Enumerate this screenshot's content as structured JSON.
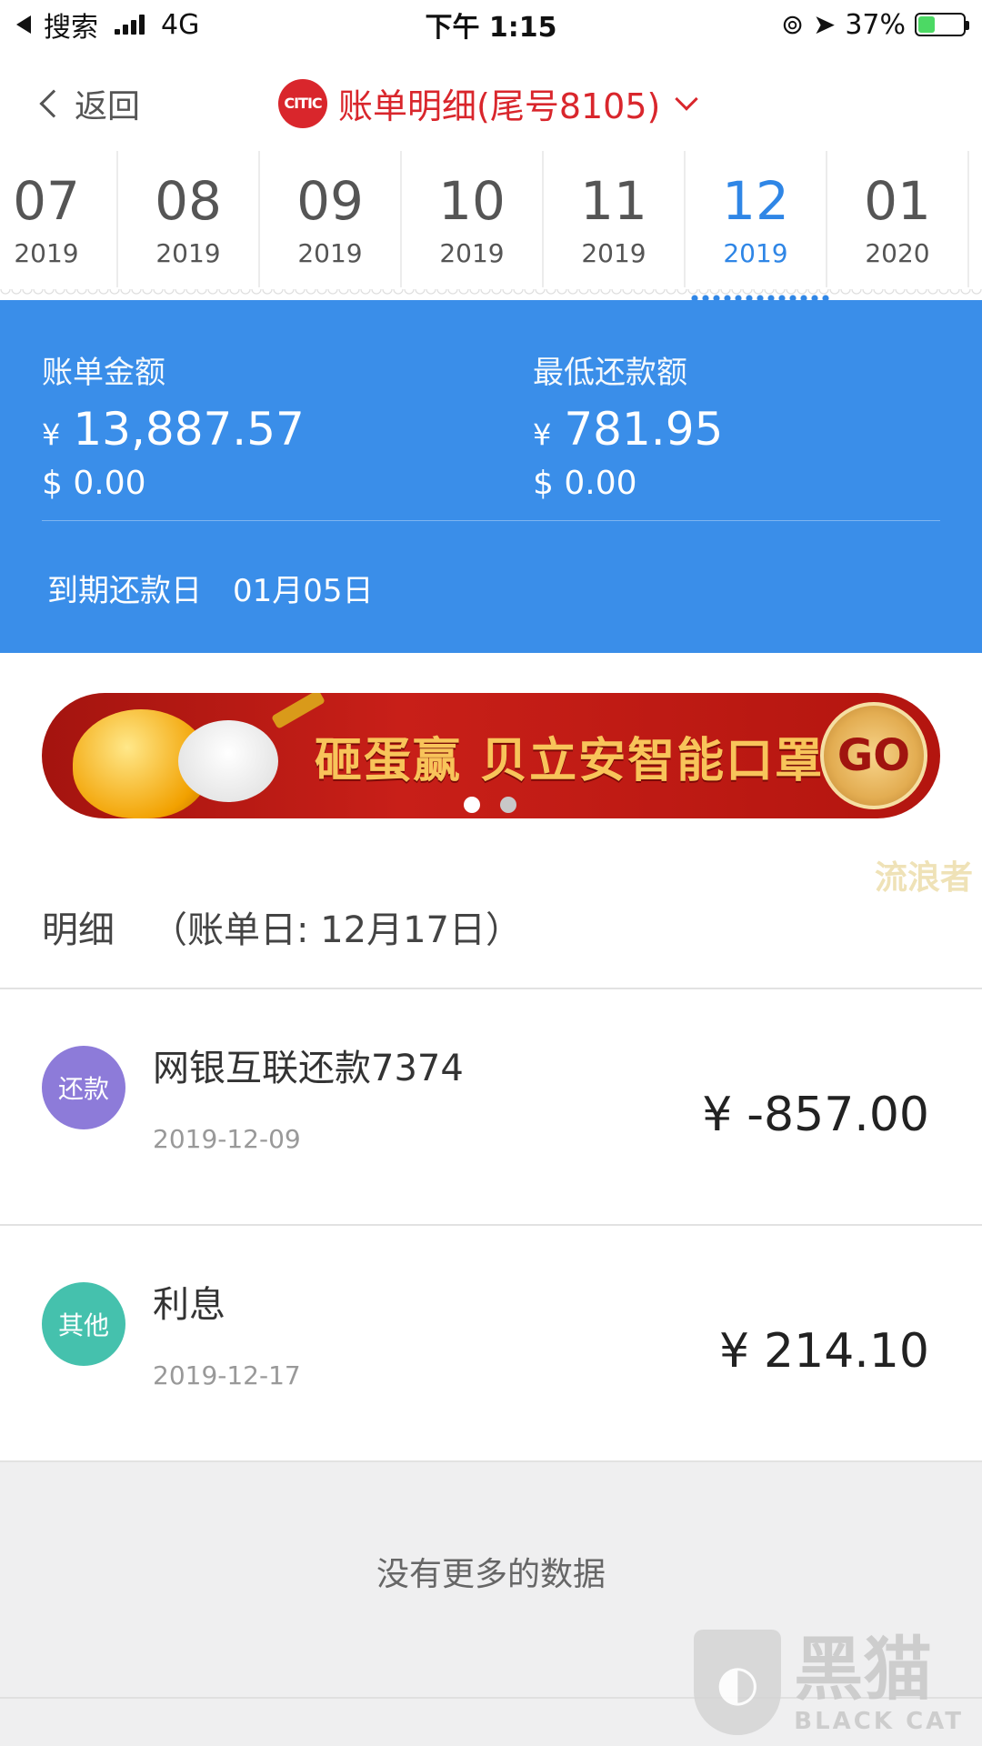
{
  "status_bar": {
    "back_app": "搜索",
    "network": "4G",
    "time": "下午 1:15",
    "battery_percent": "37%",
    "battery_level": 0.37
  },
  "nav": {
    "back_label": "返回",
    "bank_logo_text": "CITIC",
    "title": "账单明细(尾号8105)"
  },
  "months": [
    {
      "month": "07",
      "year": "2019",
      "active": false
    },
    {
      "month": "08",
      "year": "2019",
      "active": false
    },
    {
      "month": "09",
      "year": "2019",
      "active": false
    },
    {
      "month": "10",
      "year": "2019",
      "active": false
    },
    {
      "month": "11",
      "year": "2019",
      "active": false
    },
    {
      "month": "12",
      "year": "2019",
      "active": true
    },
    {
      "month": "01",
      "year": "2020",
      "active": false
    }
  ],
  "summary": {
    "bill_amount_label": "账单金额",
    "bill_amount_currency": "¥",
    "bill_amount": "13,887.57",
    "bill_amount_usd": "$ 0.00",
    "min_payment_label": "最低还款额",
    "min_payment_currency": "¥",
    "min_payment": "781.95",
    "min_payment_usd": "$ 0.00",
    "due_date_label": "到期还款日",
    "due_date": "01月05日"
  },
  "banner": {
    "text": "砸蛋赢 贝立安智能口罩",
    "go_label": "GO"
  },
  "watermark_text": "流浪者",
  "details": {
    "label": "明细",
    "statement_date": "（账单日: 12月17日）"
  },
  "transactions": [
    {
      "badge": "还款",
      "title": "网银互联还款7374",
      "date": "2019-12-09",
      "currency": "¥",
      "amount": "-857.00",
      "badge_color": "#8d7bd9"
    },
    {
      "badge": "其他",
      "title": "利息",
      "date": "2019-12-17",
      "currency": "¥",
      "amount": "214.10",
      "badge_color": "#45c1ad"
    }
  ],
  "footer": {
    "no_more": "没有更多的数据"
  },
  "blackcat": {
    "cn": "黑猫",
    "en": "BLACK CAT"
  },
  "colors": {
    "accent_blue": "#3a8ee9",
    "title_red": "#d9262c"
  }
}
